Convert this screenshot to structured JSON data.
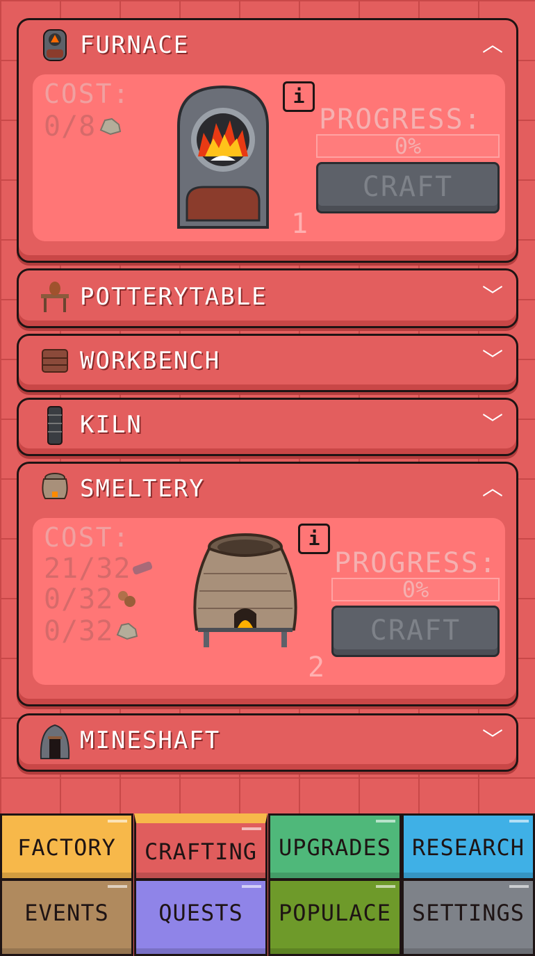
{
  "panels": [
    {
      "title": "FURNACE",
      "expanded": true,
      "chevron": "^",
      "cost_label": "COST:",
      "costs": [
        {
          "text": "0/8",
          "icon": "stone-icon"
        }
      ],
      "progress_label": "PROGRESS:",
      "progress_text": "0%",
      "progress": 0,
      "craft_label": "CRAFT",
      "count": "1"
    },
    {
      "title": "POTTERYTABLE",
      "expanded": false,
      "chevron": "v"
    },
    {
      "title": "WORKBENCH",
      "expanded": false,
      "chevron": "v"
    },
    {
      "title": "KILN",
      "expanded": false,
      "chevron": "v"
    },
    {
      "title": "SMELTERY",
      "expanded": true,
      "chevron": "^",
      "cost_label": "COST:",
      "costs": [
        {
          "text": "21/32",
          "icon": "brick-icon"
        },
        {
          "text": "0/32",
          "icon": "clay-icon"
        },
        {
          "text": "0/32",
          "icon": "stone-icon"
        }
      ],
      "progress_label": "PROGRESS:",
      "progress_text": "0%",
      "progress": 0,
      "craft_label": "CRAFT",
      "count": "2"
    },
    {
      "title": "MINESHAFT",
      "expanded": false,
      "chevron": "v"
    }
  ],
  "nav": [
    {
      "label": "FACTORY",
      "color": "#f7b84a"
    },
    {
      "label": "CRAFTING",
      "color": "#e05d5d",
      "active": true
    },
    {
      "label": "UPGRADES",
      "color": "#4fb87a"
    },
    {
      "label": "RESEARCH",
      "color": "#3fb0e6"
    },
    {
      "label": "EVENTS",
      "color": "#b08a5e"
    },
    {
      "label": "QUESTS",
      "color": "#8f84e8"
    },
    {
      "label": "POPULACE",
      "color": "#6e9a2a"
    },
    {
      "label": "SETTINGS",
      "color": "#7e8289"
    }
  ],
  "chevrons": {
    "up": "︿",
    "down": "﹀"
  }
}
